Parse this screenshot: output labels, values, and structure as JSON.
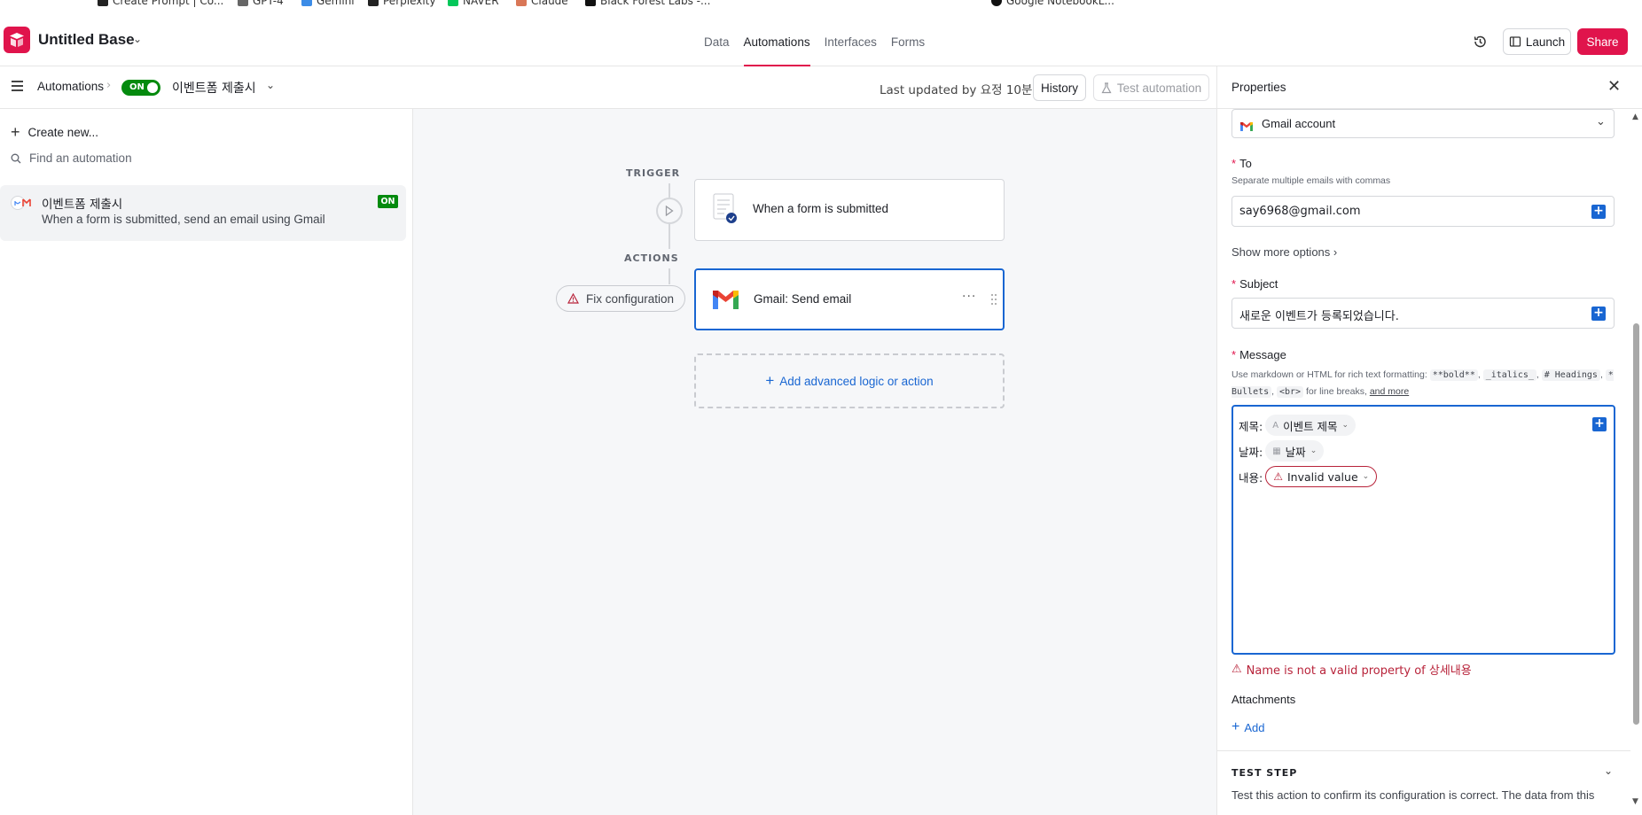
{
  "bookmarks": [
    {
      "label": "Create Prompt | Co...",
      "color": "#222"
    },
    {
      "label": "GPT-4",
      "color": "#666"
    },
    {
      "label": "Gemini",
      "color": "#3c8ce7"
    },
    {
      "label": "Perplexity",
      "color": "#222"
    },
    {
      "label": "NAVER",
      "color": "#03c75a"
    },
    {
      "label": "Claude",
      "color": "#d97757"
    },
    {
      "label": "Black Forest Labs -...",
      "color": "#111"
    },
    {
      "label": "Google NotebookL...",
      "color": "#111"
    }
  ],
  "header": {
    "base_title": "Untitled Base",
    "tabs": [
      {
        "label": "Data",
        "active": false
      },
      {
        "label": "Automations",
        "active": true
      },
      {
        "label": "Interfaces",
        "active": false
      },
      {
        "label": "Forms",
        "active": false
      }
    ],
    "launch_label": "Launch",
    "share_label": "Share",
    "accent": "#e0144c"
  },
  "subbar": {
    "crumb": "Automations",
    "toggle_label": "ON",
    "automation_name": "이벤트폼 제출시",
    "last_updated": "Last updated by 요정 10분",
    "history_label": "History",
    "test_label": "Test automation"
  },
  "sidebar": {
    "create_label": "Create new...",
    "find_placeholder": "Find an automation",
    "items": [
      {
        "name": "이벤트폼 제출시",
        "description": "When a form is submitted, send an email using Gmail",
        "badge": "ON"
      }
    ]
  },
  "canvas": {
    "trigger_label": "TRIGGER",
    "actions_label": "ACTIONS",
    "trigger_node": "When a form is submitted",
    "action_node": "Gmail: Send email",
    "fix_label": "Fix configuration",
    "add_logic_label": "Add advanced logic or action"
  },
  "panel": {
    "title": "Properties",
    "account": "Gmail account",
    "to_label": "To",
    "to_help": "Separate multiple emails with commas",
    "to_value": "say6968@gmail.com",
    "show_more": "Show more options",
    "subject_label": "Subject",
    "subject_value": "새로운 이벤트가 등록되었습니다.",
    "message_label": "Message",
    "message_help": {
      "prefix": "Use markdown or HTML for rich text formatting:",
      "bold": "**bold**",
      "italics": "_italics_",
      "headings": "# Headings",
      "bullets": "* Bullets",
      "br": "<br>",
      "line_breaks": "for line breaks,",
      "and_more": "and more"
    },
    "message_lines": [
      {
        "prefix": "제목:",
        "token": "이벤트 제목",
        "icon": "text-field-icon",
        "invalid": false
      },
      {
        "prefix": "날짜:",
        "token": "날짜",
        "icon": "calendar-icon",
        "invalid": false
      },
      {
        "prefix": "내용:",
        "token": "Invalid value",
        "icon": "warning-icon",
        "invalid": true
      }
    ],
    "error": "Name is not a valid property of 상세내용",
    "attachments_label": "Attachments",
    "add_label": "Add",
    "test_step_label": "TEST STEP",
    "test_step_desc": "Test this action to confirm its configuration is correct. The data from this"
  },
  "colors": {
    "blue": "#1966d2",
    "green": "#048a0e",
    "error": "#b8233a"
  }
}
